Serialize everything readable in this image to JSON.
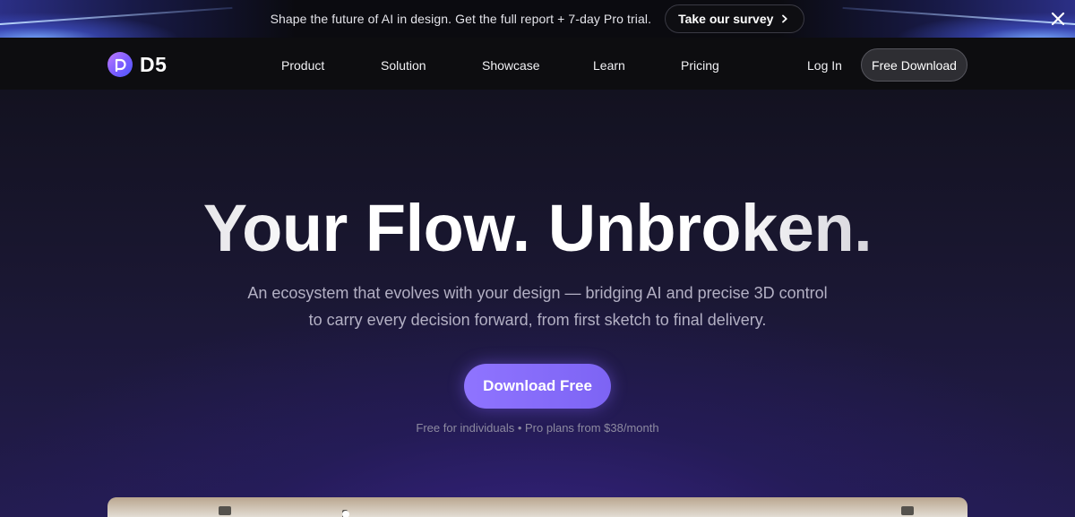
{
  "announcement": {
    "message": "Shape the future of AI in design. Get the full report + 7-day Pro trial.",
    "survey_label": "Take our survey",
    "close_icon": "close-icon"
  },
  "nav": {
    "logo_text": "D5",
    "items": [
      {
        "label": "Product"
      },
      {
        "label": "Solution"
      },
      {
        "label": "Showcase"
      },
      {
        "label": "Learn"
      },
      {
        "label": "Pricing"
      }
    ],
    "login_label": "Log In",
    "download_label": "Free Download"
  },
  "hero": {
    "headline": "Your Flow. Unbroken.",
    "subhead_line1": "An ecosystem that evolves with your design — bridging AI and precise 3D control",
    "subhead_line2": "to carry every decision forward, from first sketch to final delivery.",
    "cta_label": "Download Free",
    "pricing_note": "Free for individuals • Pro plans from $38/month"
  },
  "colors": {
    "accent": "#8b72ff",
    "nav_bg": "#0d0d10",
    "hero_bg": "#1a1732"
  }
}
